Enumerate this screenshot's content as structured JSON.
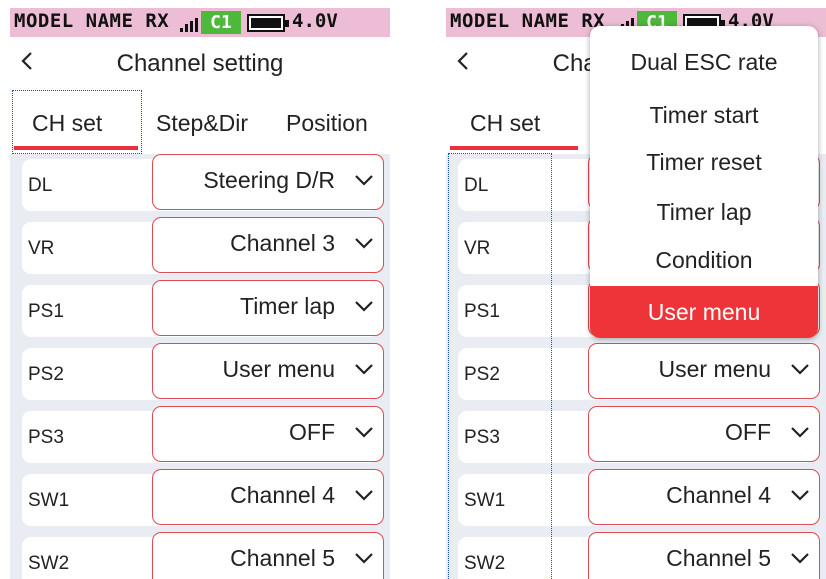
{
  "theme": {
    "status_bar_color": "#ecbdd4",
    "accent_red": "#e8303f",
    "badge_green": "#4eb83a",
    "focus_blue": "#1a50a8"
  },
  "status_bar": {
    "model_name": "MODEL NAME  RX",
    "channel_badge": "C1",
    "battery_voltage": "4.0V"
  },
  "header": {
    "back_icon": "chevron-left-icon",
    "title": "Channel setting"
  },
  "tabs": [
    {
      "label": "CH set",
      "active": true
    },
    {
      "label": "Step&Dir",
      "active": false
    },
    {
      "label": "Position",
      "active": false
    }
  ],
  "channel_rows": [
    {
      "label": "DL",
      "value": "Steering D/R"
    },
    {
      "label": "VR",
      "value": "Channel 3"
    },
    {
      "label": "PS1",
      "value": "Timer lap"
    },
    {
      "label": "PS2",
      "value": "User menu"
    },
    {
      "label": "PS3",
      "value": "OFF"
    },
    {
      "label": "SW1",
      "value": "Channel 4"
    },
    {
      "label": "SW2",
      "value": "Channel 5"
    }
  ],
  "dropdown_menu": {
    "options": [
      "Dual ESC rate",
      "Timer start",
      "Timer reset",
      "Timer lap",
      "Condition",
      "User menu"
    ],
    "selected": "User menu"
  }
}
